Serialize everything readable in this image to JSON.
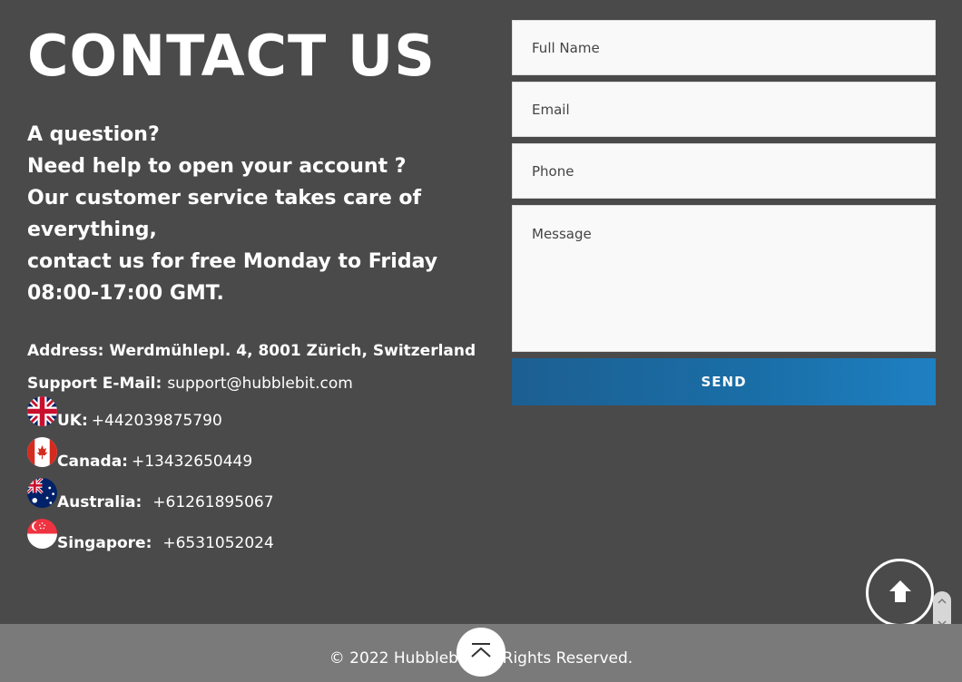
{
  "contact": {
    "title": "CONTACT US",
    "intro_lines": [
      "A question?",
      "Need help to open your account ?",
      "Our customer service takes care of everything,",
      "contact us for free Monday to Friday 08:00-17:00 GMT."
    ],
    "address": "Address: Werdmühlepl. 4, 8001 Zürich, Switzerland",
    "support_label": "Support E-Mail:",
    "support_email": "support@hubblebit.com",
    "countries": [
      {
        "label": "UK:",
        "phone": "+442039875790",
        "flag": "uk-flag-icon"
      },
      {
        "label": "Canada:",
        "phone": "+13432650449",
        "flag": "canada-flag-icon"
      },
      {
        "label": "Australia:",
        "phone": "+61261895067",
        "flag": "australia-flag-icon"
      },
      {
        "label": "Singapore:",
        "phone": "+6531052024",
        "flag": "singapore-flag-icon"
      }
    ]
  },
  "form": {
    "full_name_placeholder": "Full Name",
    "email_placeholder": "Email",
    "phone_placeholder": "Phone",
    "message_placeholder": "Message",
    "send_label": "SEND"
  },
  "footer": {
    "copyright": "© 2022 Hubblebit. All Rights Reserved."
  },
  "icons": {
    "scroll_top": "arrow-up-icon",
    "back_to_top": "chevron-up-icon"
  },
  "colors": {
    "background": "#4a4a4b",
    "footer": "#7a7a7a",
    "send_button": "#1a6fa8"
  }
}
